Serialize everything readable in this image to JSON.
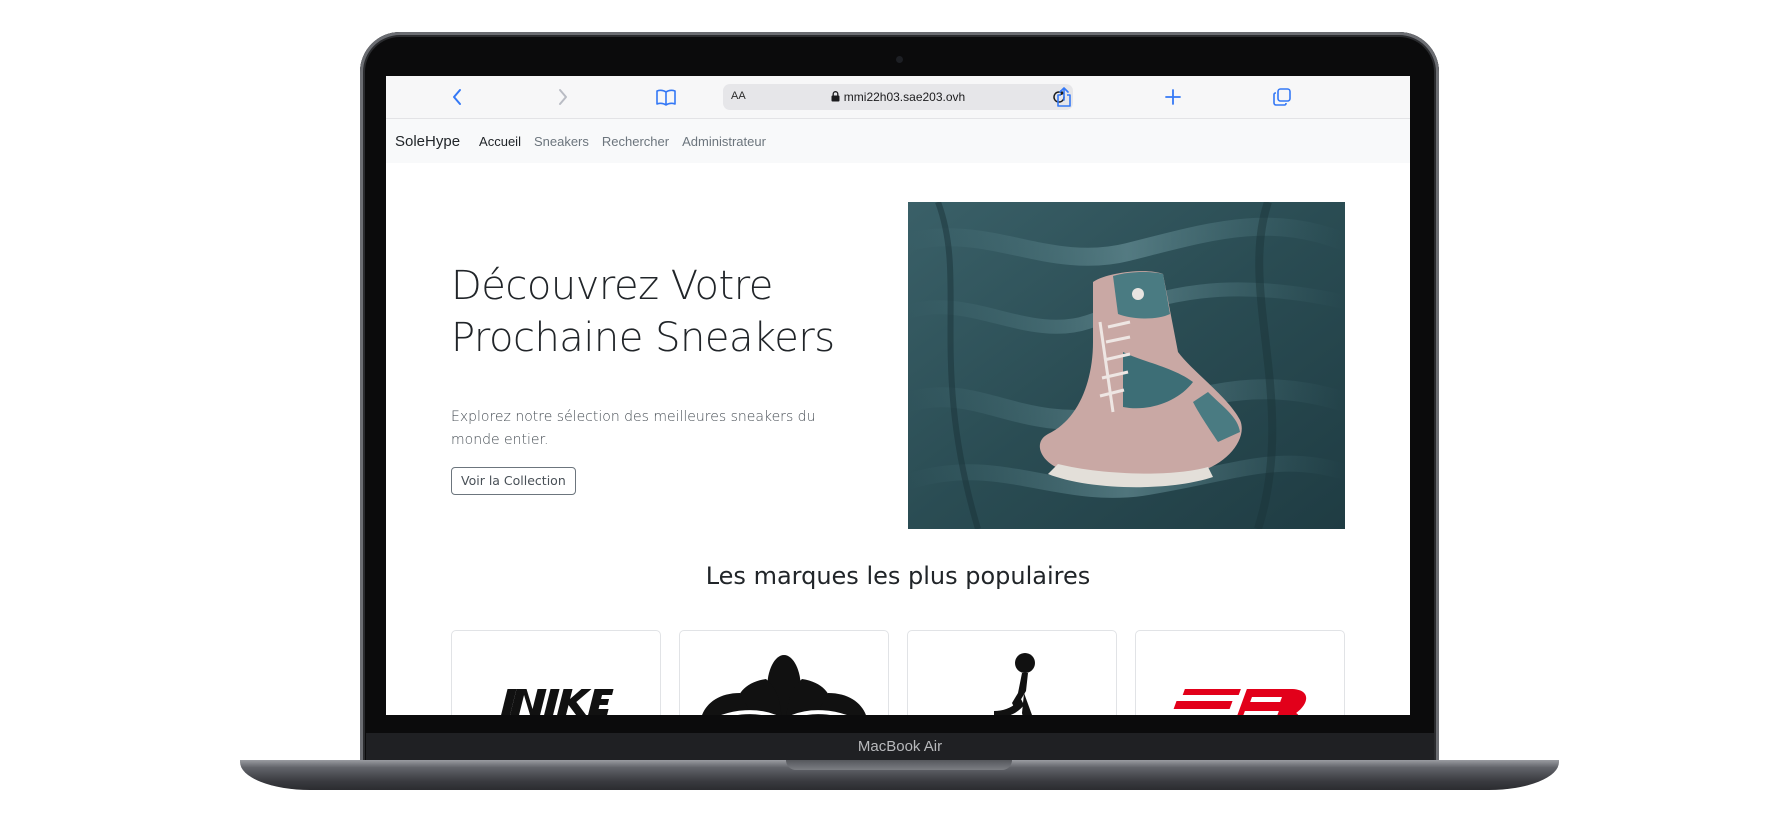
{
  "browser": {
    "text_size_label": "AA",
    "url": "mmi22h03.sae203.ovh"
  },
  "site": {
    "brand": "SoleHype",
    "nav": {
      "home": "Accueil",
      "sneakers": "Sneakers",
      "search": "Rechercher",
      "admin": "Administrateur"
    }
  },
  "hero": {
    "title": "Découvrez Votre Prochaine Sneakers",
    "subtitle": "Explorez notre sélection des meilleures sneakers du monde entier.",
    "button_label": "Voir la Collection"
  },
  "brands_section": {
    "title": "Les marques les plus populaires",
    "logos": [
      "nike-logo",
      "adidas-logo",
      "jordan-logo",
      "new-balance-logo"
    ]
  },
  "device": {
    "label": "MacBook Air"
  },
  "colors": {
    "safari_accent": "#3478f6",
    "new_balance_red": "#e2001a",
    "text_dark": "#212529",
    "text_muted": "#6c757d"
  }
}
